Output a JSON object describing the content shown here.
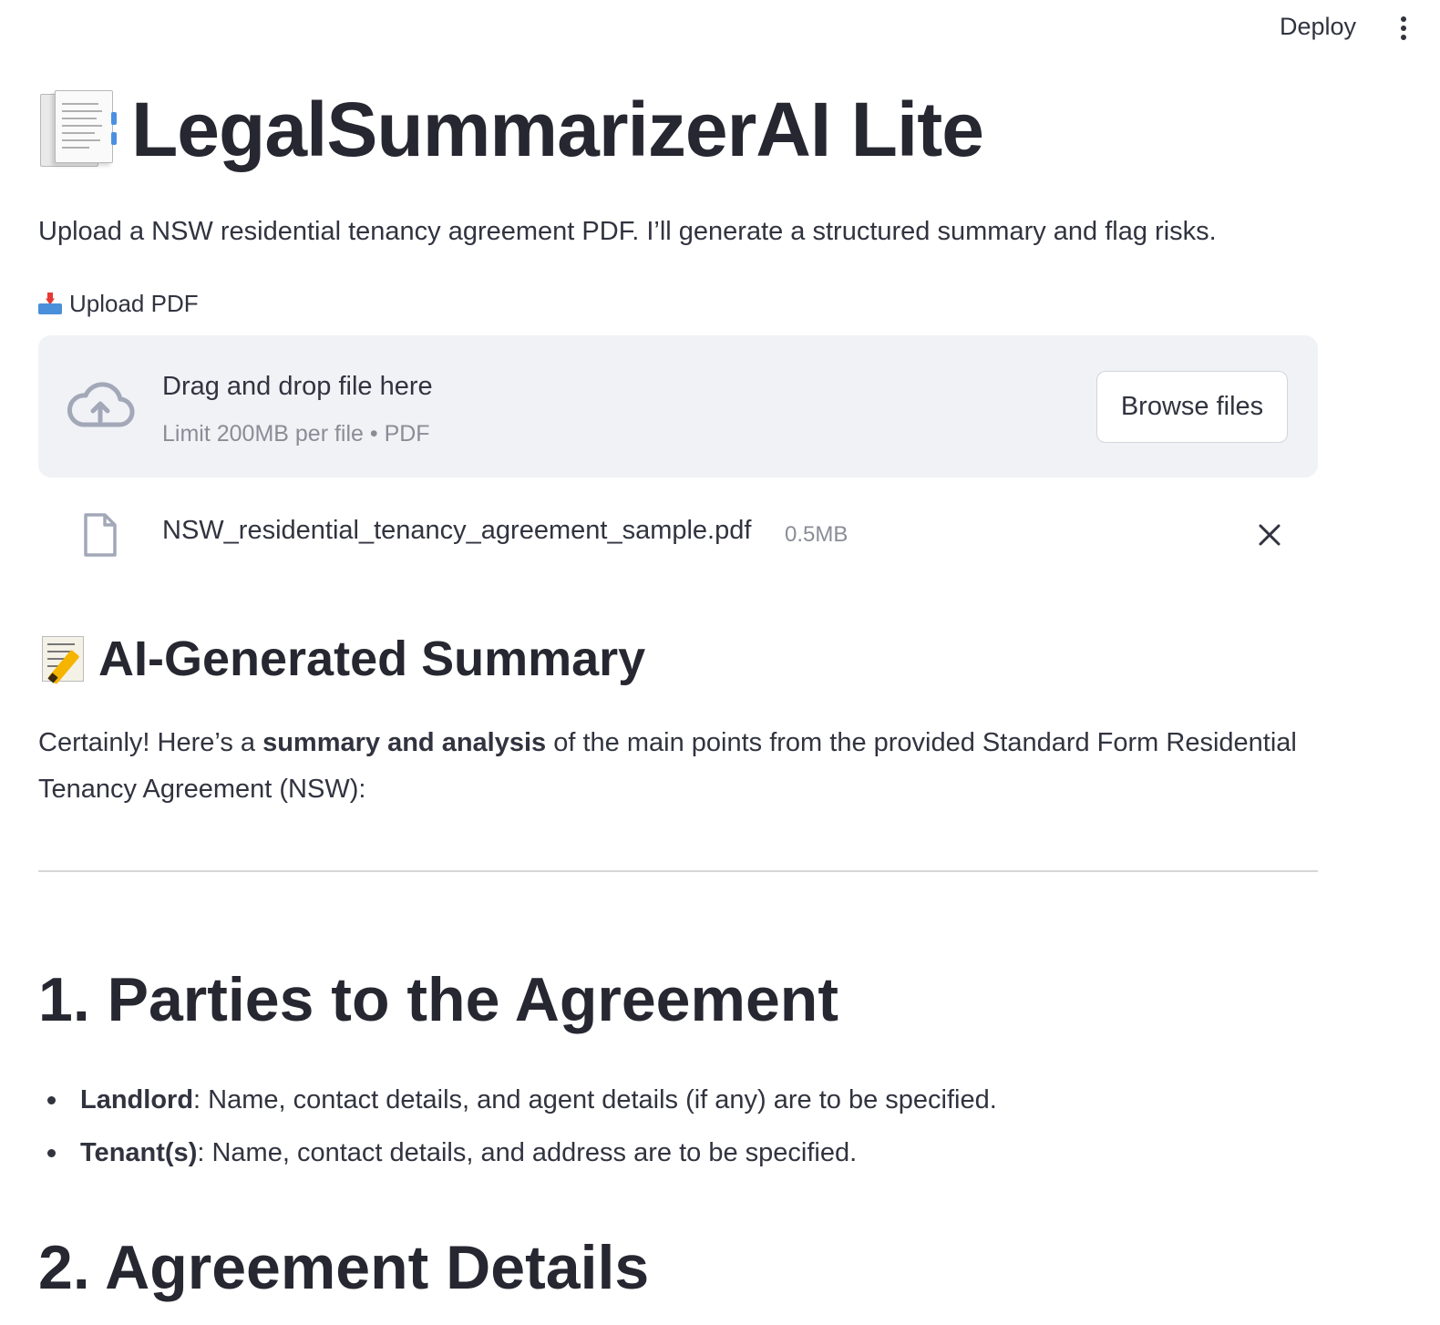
{
  "toolbar": {
    "deploy_label": "Deploy",
    "menu_icon": "kebab-menu-icon"
  },
  "header": {
    "title_icon": "page-facing-up-emoji",
    "title": "LegalSummarizerAI Lite",
    "subtitle": "Upload a NSW residential tenancy agreement PDF. I’ll generate a structured summary and flag risks."
  },
  "uploader": {
    "label_icon": "inbox-tray-emoji",
    "label": "Upload PDF",
    "drop_title": "Drag and drop file here",
    "drop_hint": "Limit 200MB per file • PDF",
    "browse_label": "Browse files",
    "cloud_icon": "cloud-upload-icon",
    "file": {
      "icon": "file-icon",
      "name": "NSW_residential_tenancy_agreement_sample.pdf",
      "size": "0.5MB",
      "remove_icon": "close-icon"
    }
  },
  "summary": {
    "icon": "memo-emoji",
    "title": "AI-Generated Summary",
    "intro_pre": "Certainly! Here’s a ",
    "intro_bold": "summary and analysis",
    "intro_post": " of the main points from the provided Standard Form Residential Tenancy Agreement (NSW):",
    "sections": [
      {
        "heading": "1. Parties to the Agreement",
        "bullets": [
          {
            "term": "Landlord",
            "text": ": Name, contact details, and agent details (if any) are to be specified."
          },
          {
            "term": "Tenant(s)",
            "text": ": Name, contact details, and address are to be specified."
          }
        ]
      },
      {
        "heading": "2. Agreement Details",
        "bullets": []
      }
    ]
  },
  "colors": {
    "text": "#31333f",
    "heading": "#262730",
    "muted": "#8a8d96",
    "dropzone_bg": "#f0f2f6",
    "icon_gray": "#a3a8b8"
  }
}
